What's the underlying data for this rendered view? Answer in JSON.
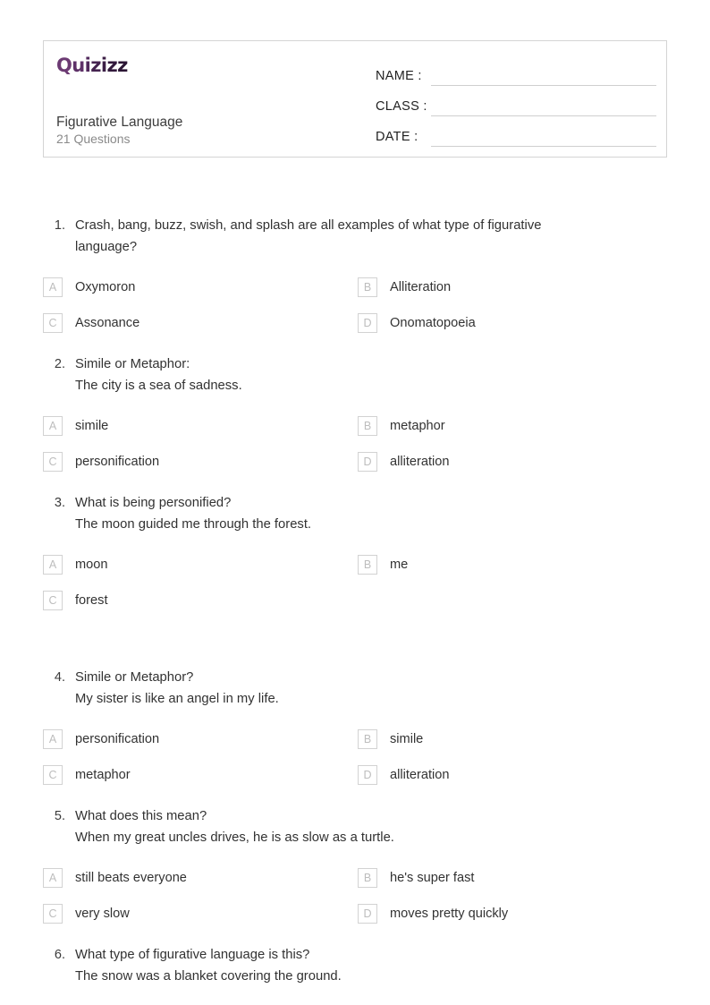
{
  "header": {
    "logo": {
      "text": "Quizizz",
      "letters": [
        "Q",
        "u",
        "i",
        "z",
        "i",
        "z",
        "z"
      ],
      "accent_color": "#6c3a73",
      "end_color": "#2b1534"
    },
    "quiz_title": "Figurative Language",
    "question_count_label": "21 Questions",
    "fields": [
      {
        "label": "NAME :",
        "value": ""
      },
      {
        "label": "CLASS :",
        "value": ""
      },
      {
        "label": "DATE  :",
        "value": ""
      }
    ]
  },
  "questions": [
    {
      "number": "1.",
      "prompt_line1": "Crash, bang, buzz, swish, and splash are all examples of what type of figurative",
      "prompt_line2": "language?",
      "options": [
        {
          "letter": "A",
          "text": "Oxymoron"
        },
        {
          "letter": "B",
          "text": "Alliteration"
        },
        {
          "letter": "C",
          "text": "Assonance"
        },
        {
          "letter": "D",
          "text": "Onomatopoeia"
        }
      ]
    },
    {
      "number": "2.",
      "prompt_line1": "Simile or Metaphor:",
      "prompt_line2": "The city is a sea of sadness.",
      "options": [
        {
          "letter": "A",
          "text": "simile"
        },
        {
          "letter": "B",
          "text": "metaphor"
        },
        {
          "letter": "C",
          "text": "personification"
        },
        {
          "letter": "D",
          "text": "alliteration"
        }
      ]
    },
    {
      "number": "3.",
      "prompt_line1": "What is being personified?",
      "prompt_line2": "The moon guided me through the forest.",
      "options": [
        {
          "letter": "A",
          "text": "moon"
        },
        {
          "letter": "B",
          "text": "me"
        },
        {
          "letter": "C",
          "text": "forest"
        }
      ]
    },
    {
      "number": "4.",
      "prompt_line1": "Simile or Metaphor?",
      "prompt_line2": "My sister is like an angel in my life.",
      "options": [
        {
          "letter": "A",
          "text": "personification"
        },
        {
          "letter": "B",
          "text": "simile"
        },
        {
          "letter": "C",
          "text": "metaphor"
        },
        {
          "letter": "D",
          "text": "alliteration"
        }
      ]
    },
    {
      "number": "5.",
      "prompt_line1": "What does this mean?",
      "prompt_line2": "When my great uncles drives, he is as slow as a turtle.",
      "options": [
        {
          "letter": "A",
          "text": "still beats everyone"
        },
        {
          "letter": "B",
          "text": "he's super fast"
        },
        {
          "letter": "C",
          "text": "very slow"
        },
        {
          "letter": "D",
          "text": "moves pretty quickly"
        }
      ]
    },
    {
      "number": "6.",
      "prompt_line1": "What type of figurative language is this?",
      "prompt_line2": "The snow was a blanket covering the ground.",
      "options": []
    }
  ]
}
